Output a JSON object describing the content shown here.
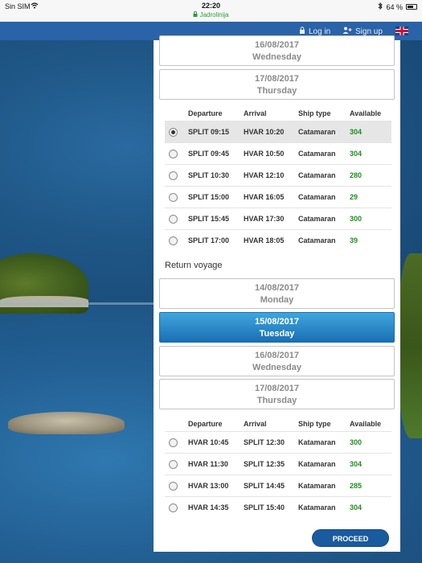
{
  "status_bar": {
    "carrier": "Sin SIM",
    "time": "22:20",
    "url": "Jadrolinija",
    "battery": "64 %"
  },
  "nav": {
    "login": "Log in",
    "signup": "Sign up",
    "language_icon": "uk-flag-icon"
  },
  "outbound": {
    "dates": [
      {
        "date": "16/08/2017",
        "day": "Wednesday"
      },
      {
        "date": "17/08/2017",
        "day": "Thursday"
      }
    ],
    "columns": {
      "departure": "Departure",
      "arrival": "Arrival",
      "ship_type": "Ship type",
      "available": "Available"
    },
    "rows": [
      {
        "departure": "SPLIT 09:15",
        "arrival": "HVAR 10:20",
        "ship_type": "Catamaran",
        "available": "304",
        "selected": true
      },
      {
        "departure": "SPLIT 09:45",
        "arrival": "HVAR 10:50",
        "ship_type": "Catamaran",
        "available": "304",
        "selected": false
      },
      {
        "departure": "SPLIT 10:30",
        "arrival": "HVAR 12:10",
        "ship_type": "Catamaran",
        "available": "280",
        "selected": false
      },
      {
        "departure": "SPLIT 15:00",
        "arrival": "HVAR 16:05",
        "ship_type": "Catamaran",
        "available": "29",
        "selected": false
      },
      {
        "departure": "SPLIT 15:45",
        "arrival": "HVAR 17:30",
        "ship_type": "Catamaran",
        "available": "300",
        "selected": false
      },
      {
        "departure": "SPLIT 17:00",
        "arrival": "HVAR 18:05",
        "ship_type": "Catamaran",
        "available": "39",
        "selected": false
      }
    ]
  },
  "return": {
    "title": "Return voyage",
    "dates": [
      {
        "date": "14/08/2017",
        "day": "Monday",
        "active": false
      },
      {
        "date": "15/08/2017",
        "day": "Tuesday",
        "active": true
      },
      {
        "date": "16/08/2017",
        "day": "Wednesday",
        "active": false
      },
      {
        "date": "17/08/2017",
        "day": "Thursday",
        "active": false
      }
    ],
    "columns": {
      "departure": "Departure",
      "arrival": "Arrival",
      "ship_type": "Ship type",
      "available": "Available"
    },
    "rows": [
      {
        "departure": "HVAR 10:45",
        "arrival": "SPLIT 12:30",
        "ship_type": "Katamaran",
        "available": "300"
      },
      {
        "departure": "HVAR 11:30",
        "arrival": "SPLIT 12:35",
        "ship_type": "Katamaran",
        "available": "304"
      },
      {
        "departure": "HVAR 13:00",
        "arrival": "SPLIT 14:45",
        "ship_type": "Katamaran",
        "available": "285"
      },
      {
        "departure": "HVAR 14:35",
        "arrival": "SPLIT 15:40",
        "ship_type": "Katamaran",
        "available": "304"
      }
    ]
  },
  "proceed_label": "PROCEED",
  "colors": {
    "nav": "#2b63a8",
    "active_date": "#1a6fb3",
    "available_text": "#1e8e1e",
    "proceed": "#1a5a9e"
  }
}
